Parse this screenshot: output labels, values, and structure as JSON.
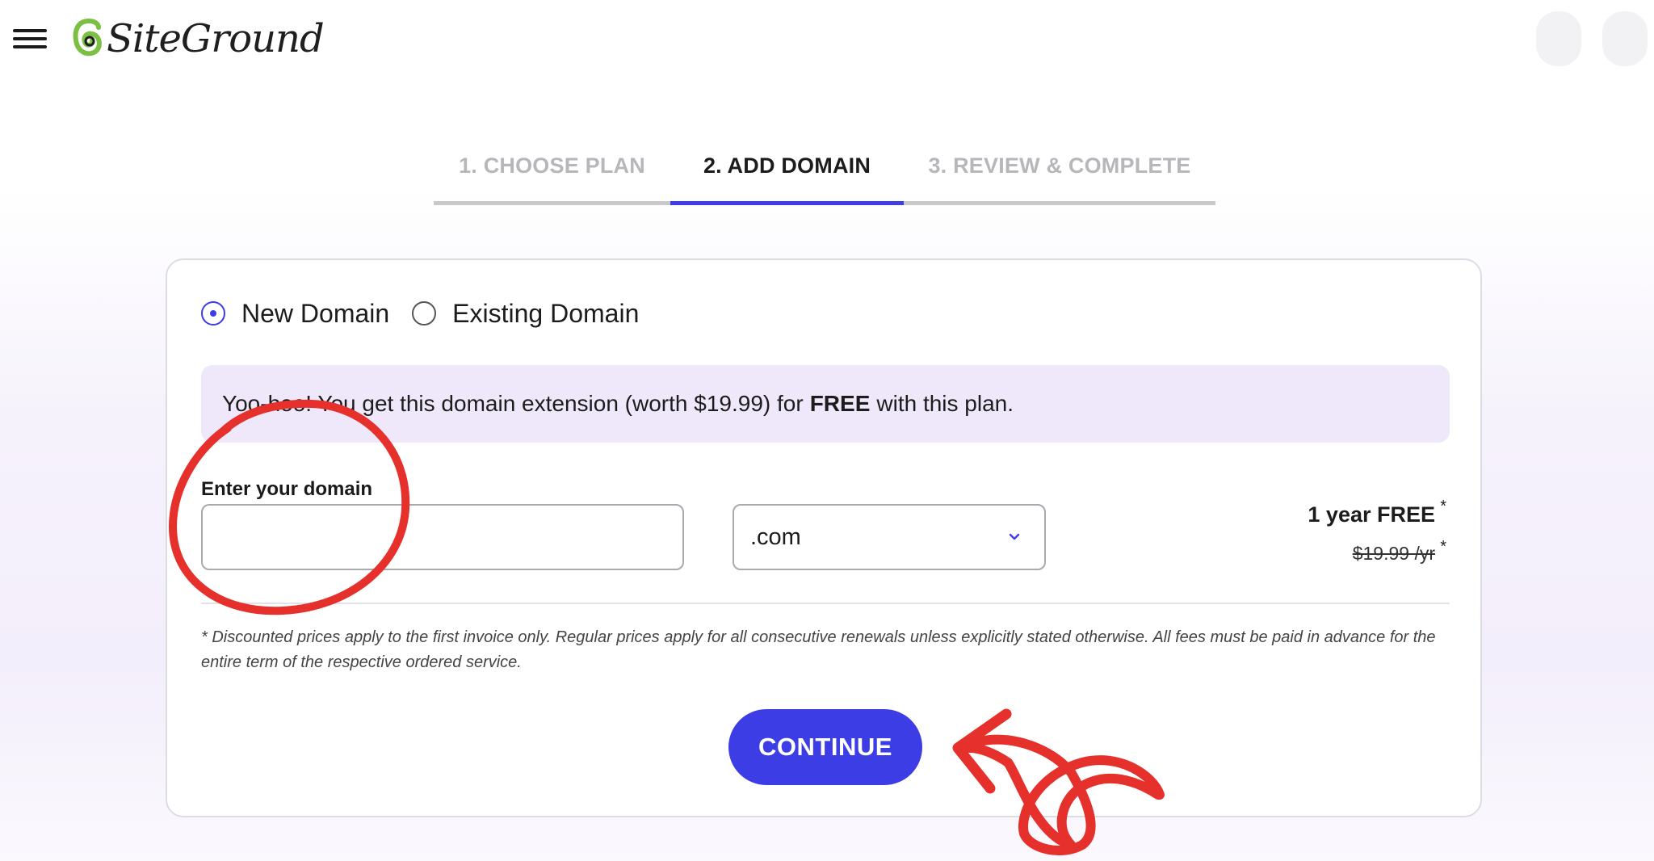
{
  "header": {
    "logo_text": "SiteGround",
    "menu_icon": "hamburger-menu-icon",
    "logo_mark_icon": "swirl-logo-icon"
  },
  "steps": [
    {
      "label": "1. CHOOSE PLAN",
      "state": "inactive"
    },
    {
      "label": "2. ADD DOMAIN",
      "state": "active"
    },
    {
      "label": "3. REVIEW & COMPLETE",
      "state": "inactive"
    }
  ],
  "domain_type": {
    "options": [
      {
        "label": "New Domain",
        "checked": true
      },
      {
        "label": "Existing Domain",
        "checked": false
      }
    ]
  },
  "promo": {
    "prefix": "Yoo-hoo! You get this domain extension (worth $19.99) for",
    "bold": "FREE",
    "suffix": "with this plan."
  },
  "domain_form": {
    "label": "Enter your domain",
    "value": "",
    "placeholder": "",
    "tld_selected": ".com"
  },
  "pricing": {
    "free_label": "1 year FREE",
    "old_price": "$19.99 /yr",
    "asterisk": "*"
  },
  "disclaimer": "* Discounted prices apply to the first invoice only. Regular prices apply for all consecutive renewals unless explicitly stated otherwise. All fees must be paid in advance for the entire term of the respective ordered service.",
  "continue_label": "CONTINUE",
  "colors": {
    "accent": "#3d3de6",
    "promo_bg": "#efe8fa",
    "annotation": "#e5302b"
  }
}
